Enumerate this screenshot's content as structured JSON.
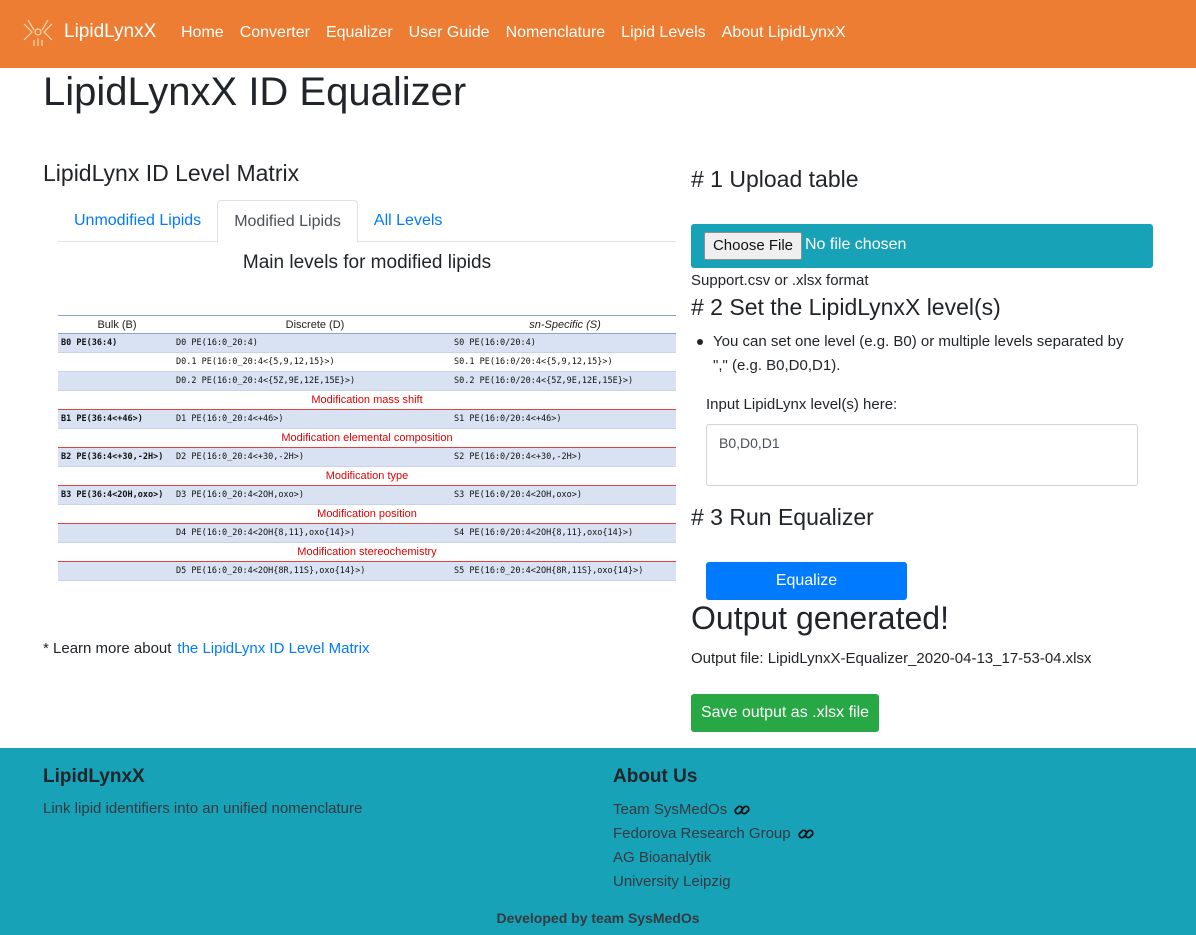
{
  "nav": {
    "brand": "LipidLynxX",
    "links": [
      "Home",
      "Converter",
      "Equalizer",
      "User Guide",
      "Nomenclature",
      "Lipid Levels",
      "About LipidLynxX"
    ]
  },
  "page": {
    "title": "LipidLynxX ID Equalizer"
  },
  "matrix": {
    "title": "LipidLynx ID Level Matrix",
    "tabs": [
      "Unmodified Lipids",
      "Modified Lipids",
      "All Levels"
    ],
    "active_tab": "Modified Lipids",
    "heading": "Main levels for modified lipids",
    "columns": [
      "Bulk (B)",
      "Discrete (D)",
      "sn-Specific (S)"
    ],
    "rows": [
      [
        "B0 PE(36:4)",
        "D0   PE(16:0_20:4)",
        "S0   PE(16:0/20:4)"
      ],
      [
        "",
        "D0.1 PE(16:0_20:4<{5,9,12,15}>)",
        "S0.1 PE(16:0/20:4<{5,9,12,15}>)"
      ],
      [
        "",
        "D0.2 PE(16:0_20:4<{5Z,9E,12E,15E}>)",
        "S0.2 PE(16:0/20:4<{5Z,9E,12E,15E}>)"
      ],
      "Modification mass shift",
      [
        "B1 PE(36:4<+46>)",
        "D1 PE(16:0_20:4<+46>)",
        "S1 PE(16:0/20:4<+46>)"
      ],
      "Modification elemental composition",
      [
        "B2 PE(36:4<+30,-2H>)",
        "D2 PE(16:0_20:4<+30,-2H>)",
        "S2 PE(16:0/20:4<+30,-2H>)"
      ],
      "Modification type",
      [
        "B3 PE(36:4<2OH,oxo>)",
        "D3 PE(16:0_20:4<2OH,oxo>)",
        "S3 PE(16:0/20:4<2OH,oxo>)"
      ],
      "Modification position",
      [
        "",
        "D4 PE(16:0_20:4<2OH{8,11},oxo{14}>)",
        "S4 PE(16:0/20:4<2OH{8,11},oxo{14}>)"
      ],
      "Modification stereochemistry",
      [
        "",
        "D5 PE(16:0_20:4<2OH{8R,11S},oxo{14}>)",
        "S5 PE(16:0_20:4<2OH{8R,11S},oxo{14}>)"
      ]
    ],
    "learn_prefix": "* Learn more about",
    "learn_link": "the LipidLynx ID Level Matrix"
  },
  "form": {
    "step1": "# 1 Upload table",
    "choose_file": "Choose File",
    "no_file": "No file chosen",
    "support": "Support.csv or .xlsx format",
    "step2": "# 2 Set the LipidLynxX level(s)",
    "bullet": "You can set one level (e.g. B0) or multiple levels separated by \",\" (e.g. B0,D0,D1).",
    "input_label": "Input LipidLynx level(s) here:",
    "input_value": "B0,D0,D1",
    "step3": "# 3 Run Equalizer",
    "equalize": "Equalize",
    "output_title": "Output generated!",
    "output_file": "Output file: LipidLynxX-Equalizer_2020-04-13_17-53-04.xlsx",
    "save": "Save output as .xlsx file"
  },
  "footer": {
    "title": "LipidLynxX",
    "tagline": "Link lipid identifiers into an unified nomenclature",
    "about_title": "About Us",
    "links": [
      "Team SysMedOs",
      "Fedorova Research Group",
      "AG Bioanalytik",
      "University Leipzig"
    ],
    "developed": "Developed by team SysMedOs"
  },
  "colors": {
    "navbar": "#ec7d33",
    "footer": "#17a2b8",
    "primary": "#007bff",
    "success": "#28a745",
    "matrix_red": "#e00000",
    "matrix_shade": "#d9e2f2"
  }
}
